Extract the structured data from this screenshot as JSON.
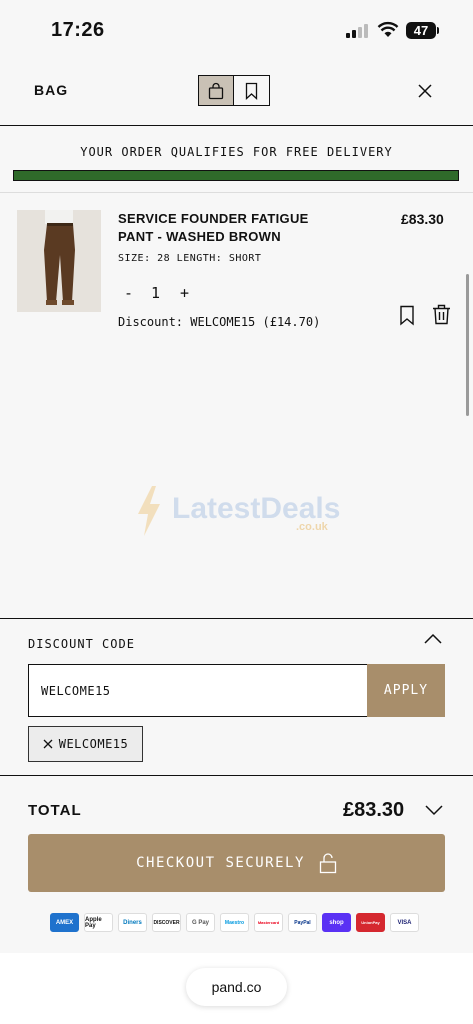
{
  "status_bar": {
    "time": "17:26",
    "battery": "47"
  },
  "header": {
    "title": "BAG"
  },
  "delivery": {
    "message": "YOUR ORDER QUALIFIES FOR FREE DELIVERY",
    "progress": 1.0
  },
  "item": {
    "name": "SERVICE FOUNDER FATIGUE PANT - WASHED BROWN",
    "price": "£83.30",
    "meta": "SIZE: 28 LENGTH: SHORT",
    "qty_minus": "-",
    "qty": "1",
    "qty_plus": "+",
    "discount": "Discount: WELCOME15 (£14.70)"
  },
  "watermark": {
    "text": "LatestDeals",
    "sub": ".co.uk"
  },
  "discount_code": {
    "label": "DISCOUNT CODE",
    "input_value": "WELCOME15",
    "apply_label": "APPLY",
    "applied_chip": "WELCOME15"
  },
  "total": {
    "label": "TOTAL",
    "value": "£83.30"
  },
  "checkout": {
    "label": "CHECKOUT SECURELY"
  },
  "payments": [
    "AMEX",
    "Apple Pay",
    "Diners",
    "DISCOVER",
    "G Pay",
    "Maestro",
    "Mastercard",
    "PayPal",
    "shop",
    "UnionPay",
    "VISA"
  ],
  "browser": {
    "url": "pand.co"
  },
  "colors": {
    "accent": "#a88e6b",
    "progress": "#2f6a2a"
  }
}
